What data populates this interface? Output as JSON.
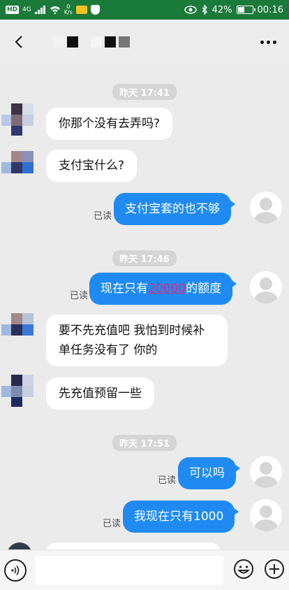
{
  "status_bar": {
    "left_chip": "HD",
    "signal_label": "4G",
    "speed_top": "0",
    "speed_bottom": "K/s",
    "battery_pct": "42%",
    "time": "00:16"
  },
  "header": {
    "back_icon": "chevron-left-icon",
    "more_icon": "more-dots-icon"
  },
  "messages": [
    {
      "type": "time",
      "text": "昨天 17:41"
    },
    {
      "type": "left",
      "text": "你那个没有去弄吗?"
    },
    {
      "type": "left",
      "text": "支付宝什么?"
    },
    {
      "type": "right",
      "text": "支付宝套的也不够",
      "read": "已读"
    },
    {
      "type": "time",
      "text": "昨天 17:46"
    },
    {
      "type": "right",
      "text_pre": "现在只有",
      "text_hl": "20000",
      "text_post": "的额度",
      "read": "已读"
    },
    {
      "type": "left",
      "text": "要不先充值吧 我怕到时候补单任务没有了 你的"
    },
    {
      "type": "left",
      "text": "先充值预留一些"
    },
    {
      "type": "time",
      "text": "昨天 17:51"
    },
    {
      "type": "right",
      "text": "可以吗",
      "read": "已读"
    },
    {
      "type": "right",
      "text": "我现在只有1000",
      "read": "已读"
    }
  ],
  "input_bar": {
    "voice_icon": "voice-icon",
    "emoji_icon": "emoji-icon",
    "plus_icon": "plus-icon"
  },
  "colors": {
    "status_bar_bg": "#1a7a3a",
    "bubble_right": "#1f8bf2",
    "bubble_left": "#ffffff",
    "highlight": "#e0297a"
  }
}
